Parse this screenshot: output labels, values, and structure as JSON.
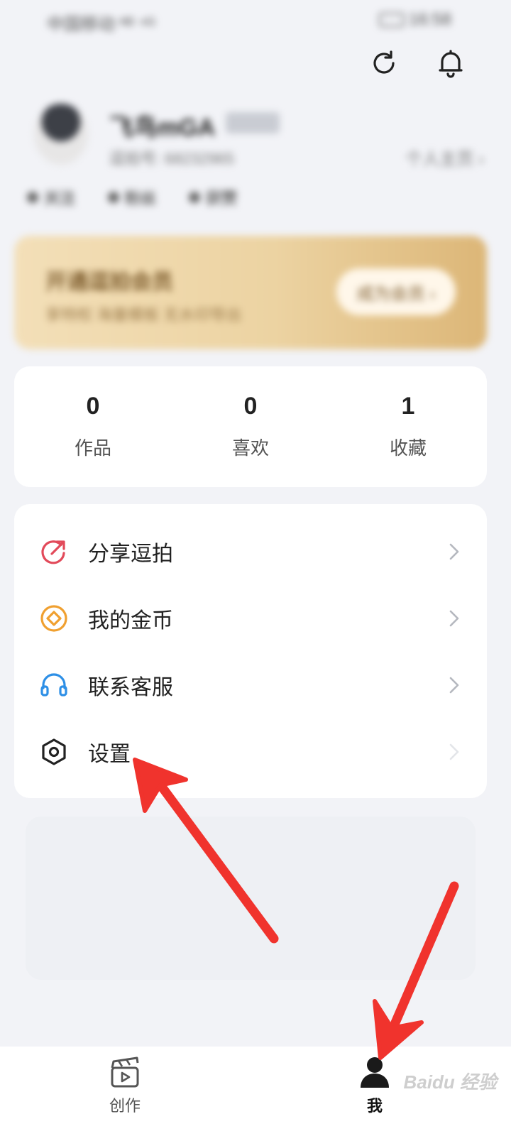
{
  "status_bar": {
    "carrier": "中国移动 ᴴᴰ ⁴ᴳ",
    "time": "16:58"
  },
  "profile": {
    "nickname": "飞鸟mGA",
    "id_text": "逗拍号: 68232965",
    "home_link": "个人主页 ›",
    "mini_stats": [
      "关注",
      "粉丝",
      "获赞"
    ]
  },
  "vip": {
    "title": "开通逗拍会员",
    "subtitle": "享特权 海量模板 无水印导出",
    "button": "成为会员 ›"
  },
  "stats": [
    {
      "count": "0",
      "label": "作品"
    },
    {
      "count": "0",
      "label": "喜欢"
    },
    {
      "count": "1",
      "label": "收藏"
    }
  ],
  "menu": [
    {
      "label": "分享逗拍",
      "icon": "share-icon",
      "color": "#e24a5a"
    },
    {
      "label": "我的金币",
      "icon": "coin-icon",
      "color": "#f0a030"
    },
    {
      "label": "联系客服",
      "icon": "headset-icon",
      "color": "#2d8fe6"
    },
    {
      "label": "设置",
      "icon": "settings-icon",
      "color": "#222222"
    }
  ],
  "bottom_nav": [
    {
      "label": "创作",
      "icon": "clapperboard-icon",
      "active": false
    },
    {
      "label": "我",
      "icon": "person-icon",
      "active": true
    }
  ],
  "watermark": "Baidu 经验",
  "colors": {
    "annotation_arrow": "#f0332d",
    "vip_gold": "#dcb677"
  }
}
